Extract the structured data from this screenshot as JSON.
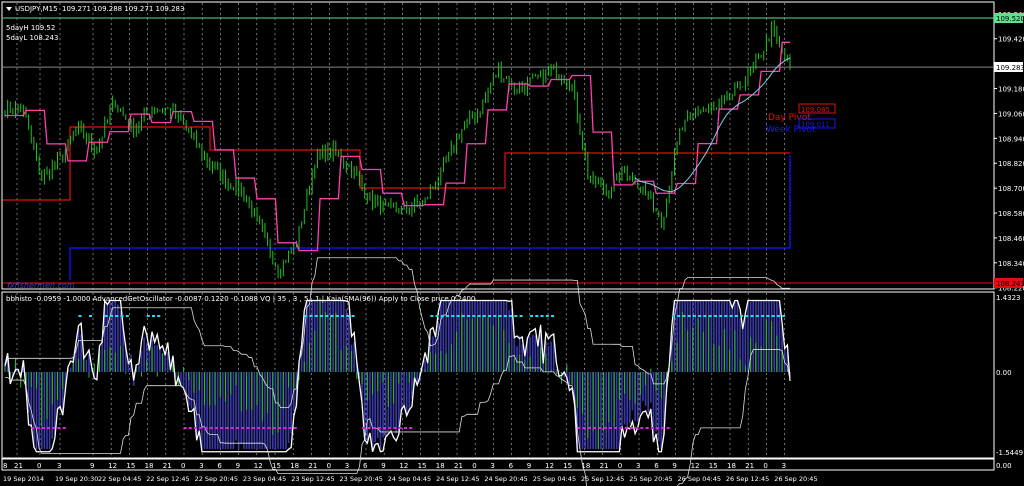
{
  "header": {
    "symbol_label": "USDJPY,M15",
    "ohlc": "109.271 109.288 109.271 109.283",
    "fivedayh": "5dayH 109.52",
    "fivedayl": "5dayL 108.243"
  },
  "watermark": "fxfishermen.com",
  "pivots": {
    "day_label": "Day Pivot",
    "day_value": "109.085",
    "week_label": "Week Pivot",
    "week_value": "109.011"
  },
  "price_scale": {
    "labels": [
      "109.540",
      "109.420",
      "109.180",
      "109.060",
      "108.940",
      "108.820",
      "108.700",
      "108.580",
      "108.460",
      "108.340",
      "108.220"
    ],
    "high_badge": "109.520",
    "current_badge": "109.283",
    "low_badge": "108.243"
  },
  "indicator": {
    "legend": "bbhisto -0.0959 -1.0000  AdvancedGetOscillator -0.0087 0.1220 -0.1088  VQ |  35 , 3 , 5 , 1  |  Kaia(SMA(96)) Apply to Close price 0.2400",
    "scale_top": "1.4323",
    "scale_zero": "0.00",
    "scale_bottom": "-1.5449",
    "sub_scale": "0.00"
  },
  "time_axis": {
    "hours": [
      "8",
      "21",
      "0",
      "3",
      "9",
      "12",
      "15",
      "18",
      "21",
      "0",
      "3",
      "6",
      "9",
      "12",
      "15",
      "18",
      "21",
      "0",
      "3",
      "6",
      "9",
      "12",
      "15",
      "18",
      "21",
      "0",
      "3",
      "6",
      "9",
      "12",
      "15",
      "18",
      "21",
      "0",
      "3",
      "6",
      "9",
      "12",
      "15",
      "18",
      "21",
      "0",
      "3"
    ],
    "dates": [
      "19 Sep 2014",
      "19 Sep 20:30",
      "22 Sep 04:45",
      "22 Sep 12:45",
      "22 Sep 20:45",
      "23 Sep 04:45",
      "23 Sep 12:45",
      "23 Sep 20:45",
      "24 Sep 04:45",
      "24 Sep 12:45",
      "24 Sep 20:45",
      "25 Sep 04:45",
      "25 Sep 12:45",
      "25 Sep 20:45",
      "26 Sep 04:45",
      "26 Sep 12:45",
      "26 Sep 20:45"
    ]
  },
  "colors": {
    "bull": "#22c022",
    "pink": "#ff3fb0",
    "red": "#e01010",
    "blue": "#1010e0",
    "green_line": "#5fe08f",
    "cyan": "#20e0f0",
    "magenta": "#e020e0",
    "hist": "#3a3aaa"
  },
  "chart_data": {
    "type": "line",
    "title": "USDJPY,M15",
    "ylim": [
      108.22,
      109.54
    ],
    "close_anchors": [
      109.08,
      109.08,
      108.74,
      108.84,
      108.98,
      108.88,
      109.12,
      108.98,
      109.08,
      109.08,
      108.98,
      108.84,
      108.74,
      108.69,
      108.5,
      108.3,
      108.45,
      108.84,
      108.88,
      108.79,
      108.64,
      108.6,
      108.6,
      108.64,
      108.79,
      108.98,
      109.08,
      109.27,
      109.17,
      109.22,
      109.27,
      109.22,
      108.74,
      108.69,
      108.79,
      108.69,
      108.55,
      108.98,
      109.08,
      109.08,
      109.17,
      109.27,
      109.46,
      109.28
    ],
    "resistance_5day_high": 109.52,
    "support_5day_low": 108.243,
    "current_price": 109.283,
    "day_pivot": 109.085,
    "week_pivot": 109.011
  }
}
